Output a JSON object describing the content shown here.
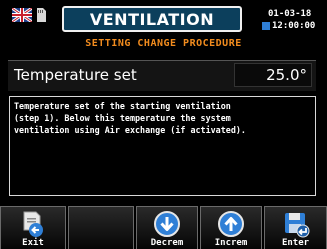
{
  "header": {
    "title": "VENTILATION",
    "date": "01-03-18",
    "time": "12:00:00",
    "subtitle": "SETTING CHANGE PROCEDURE"
  },
  "parameter": {
    "label": "Temperature set",
    "value": "25.0°"
  },
  "description": "Temperature set of the starting ventilation\n(step 1). Below this temperature the system\nventilation using Air exchange (if activated).",
  "buttons": {
    "exit": "Exit",
    "empty": "",
    "decrem": "Decrem",
    "increm": "Increm",
    "enter": "Enter"
  },
  "colors": {
    "accent": "#f28c1e",
    "title_bg": "#0c3f5c",
    "icon_blue": "#2f7fd6"
  }
}
